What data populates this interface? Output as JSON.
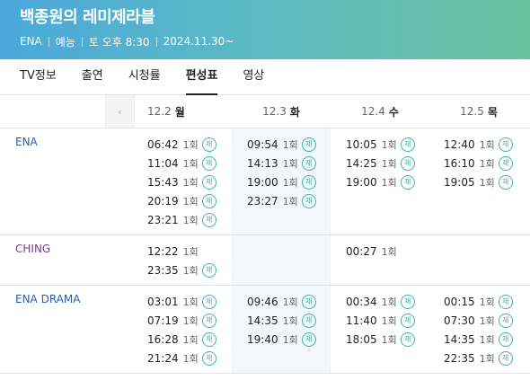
{
  "header": {
    "title": "백종원의 레미제라블",
    "channel": "ENA",
    "genre": "예능",
    "airtime": "토 오후 8:30",
    "date": "2024.11.30~"
  },
  "tabs": [
    {
      "label": "TV정보"
    },
    {
      "label": "출연"
    },
    {
      "label": "시청률"
    },
    {
      "label": "편성표"
    },
    {
      "label": "영상"
    }
  ],
  "active_tab": "편성표",
  "prev_arrow": "‹",
  "days": [
    {
      "date": "12.2",
      "weekday": "월"
    },
    {
      "date": "12.3",
      "weekday": "화"
    },
    {
      "date": "12.4",
      "weekday": "수"
    },
    {
      "date": "12.5",
      "weekday": "목"
    }
  ],
  "rerun_badge": "재",
  "channels": [
    {
      "name": "ENA",
      "color": "#2a5caa",
      "cols": [
        [
          {
            "time": "06:42",
            "ep": "1회",
            "re": true
          },
          {
            "time": "11:04",
            "ep": "1회",
            "re": true
          },
          {
            "time": "15:43",
            "ep": "1회",
            "re": true
          },
          {
            "time": "20:19",
            "ep": "1회",
            "re": true
          },
          {
            "time": "23:21",
            "ep": "1회",
            "re": true
          }
        ],
        [
          {
            "time": "09:54",
            "ep": "1회",
            "re": true
          },
          {
            "time": "14:13",
            "ep": "1회",
            "re": true
          },
          {
            "time": "19:00",
            "ep": "1회",
            "re": true
          },
          {
            "time": "23:27",
            "ep": "1회",
            "re": true
          }
        ],
        [
          {
            "time": "10:05",
            "ep": "1회",
            "re": true
          },
          {
            "time": "14:25",
            "ep": "1회",
            "re": true
          },
          {
            "time": "19:00",
            "ep": "1회",
            "re": true
          }
        ],
        [
          {
            "time": "12:40",
            "ep": "1회",
            "re": true
          },
          {
            "time": "16:10",
            "ep": "1회",
            "re": true
          },
          {
            "time": "19:05",
            "ep": "1회",
            "re": true
          }
        ]
      ]
    },
    {
      "name": "CHING",
      "color": "#7a3b8c",
      "cols": [
        [
          {
            "time": "12:22",
            "ep": "1회",
            "re": false
          },
          {
            "time": "23:35",
            "ep": "1회",
            "re": true
          }
        ],
        [],
        [
          {
            "time": "00:27",
            "ep": "1회",
            "re": false
          }
        ],
        []
      ]
    },
    {
      "name": "ENA DRAMA",
      "color": "#2a5caa",
      "cols": [
        [
          {
            "time": "03:01",
            "ep": "1회",
            "re": true
          },
          {
            "time": "07:19",
            "ep": "1회",
            "re": true
          },
          {
            "time": "16:28",
            "ep": "1회",
            "re": true
          },
          {
            "time": "21:24",
            "ep": "1회",
            "re": true
          }
        ],
        [
          {
            "time": "09:46",
            "ep": "1회",
            "re": true
          },
          {
            "time": "14:35",
            "ep": "1회",
            "re": true
          },
          {
            "time": "19:40",
            "ep": "1회",
            "re": true
          }
        ],
        [
          {
            "time": "00:34",
            "ep": "1회",
            "re": true
          },
          {
            "time": "11:40",
            "ep": "1회",
            "re": true
          },
          {
            "time": "18:05",
            "ep": "1회",
            "re": true
          }
        ],
        [
          {
            "time": "00:15",
            "ep": "1회",
            "re": true
          },
          {
            "time": "07:30",
            "ep": "1회",
            "re": true
          },
          {
            "time": "14:35",
            "ep": "1회",
            "re": true
          },
          {
            "time": "22:35",
            "ep": "1회",
            "re": true
          }
        ]
      ]
    }
  ]
}
